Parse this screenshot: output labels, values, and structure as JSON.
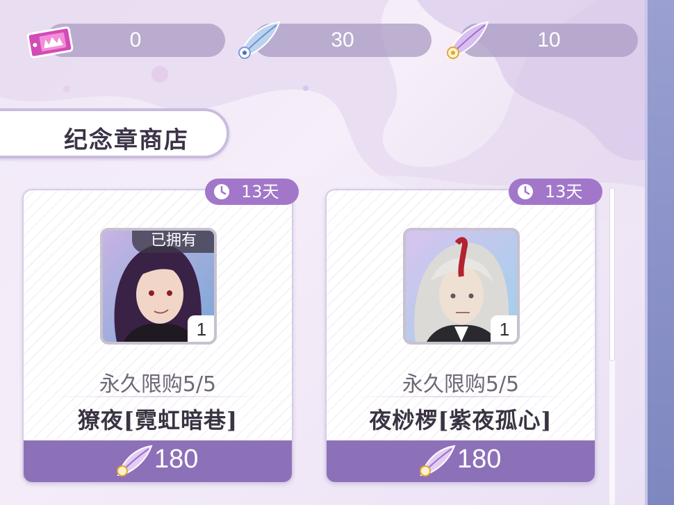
{
  "currencies": [
    {
      "icon": "ticket-icon",
      "value": "0"
    },
    {
      "icon": "blue-feather-icon",
      "value": "30"
    },
    {
      "icon": "purple-feather-icon",
      "value": "10"
    }
  ],
  "shop": {
    "title": "纪念章商店"
  },
  "cards": [
    {
      "time_left": "13天",
      "owned_label": "已拥有",
      "quantity": "1",
      "limit": "永久限购5/5",
      "name": "獠夜[霓虹暗巷]",
      "price": "180",
      "price_icon": "purple-feather-icon"
    },
    {
      "time_left": "13天",
      "quantity": "1",
      "limit": "永久限购5/5",
      "name": "夜桫椤[紫夜孤心]",
      "price": "180",
      "price_icon": "purple-feather-icon"
    }
  ],
  "scroll": {
    "position_fraction": 0.0
  }
}
